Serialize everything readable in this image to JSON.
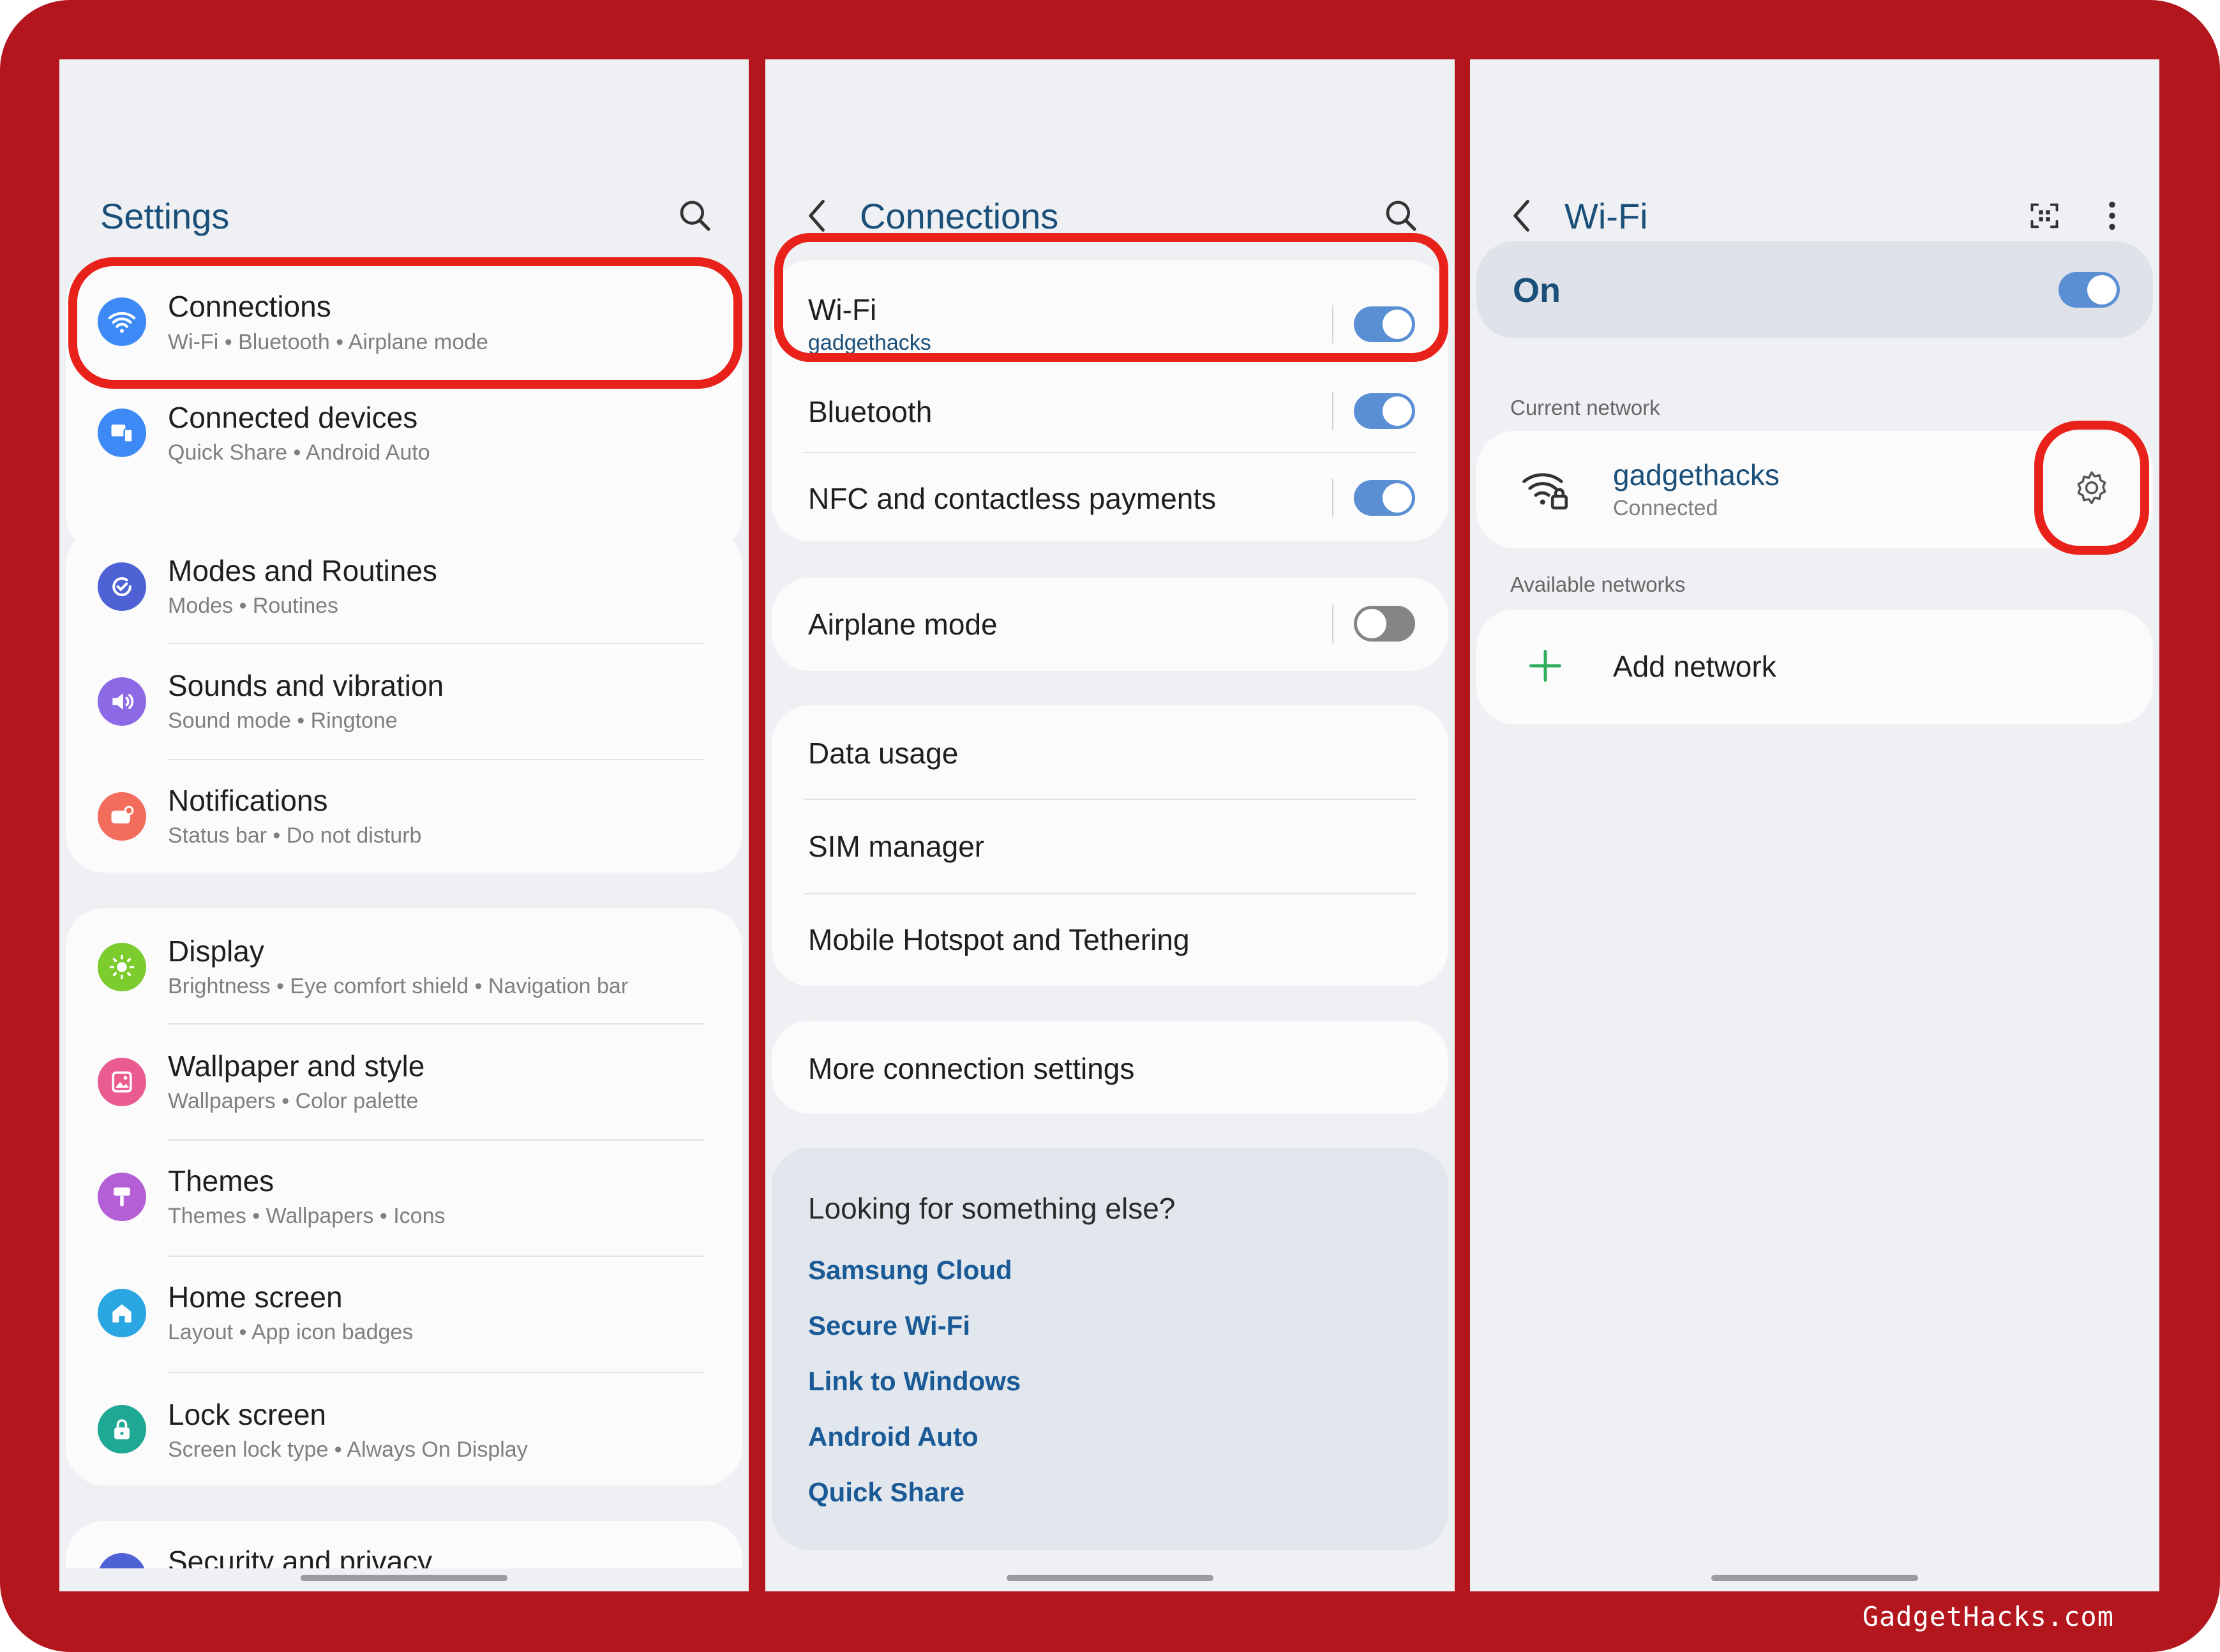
{
  "watermark": "GadgetHacks.com",
  "settings": {
    "title": "Settings",
    "items": [
      {
        "label": "Connections",
        "sub": "Wi-Fi  •  Bluetooth  •  Airplane mode",
        "icon": "wifi-icon",
        "color": "#3d8af7"
      },
      {
        "label": "Connected devices",
        "sub": "Quick Share  •  Android Auto",
        "icon": "devices-icon",
        "color": "#3d8af7"
      },
      {
        "label": "Modes and Routines",
        "sub": "Modes  •  Routines",
        "icon": "routines-icon",
        "color": "#4e62d6"
      },
      {
        "label": "Sounds and vibration",
        "sub": "Sound mode  •  Ringtone",
        "icon": "volume-icon",
        "color": "#8c6ae6"
      },
      {
        "label": "Notifications",
        "sub": "Status bar  •  Do not disturb",
        "icon": "notification-icon",
        "color": "#f36d5d"
      },
      {
        "label": "Display",
        "sub": "Brightness  •  Eye comfort shield  •  Navigation bar",
        "icon": "brightness-icon",
        "color": "#7ccc2d"
      },
      {
        "label": "Wallpaper and style",
        "sub": "Wallpapers  •  Color palette",
        "icon": "wallpaper-icon",
        "color": "#ea5b8f"
      },
      {
        "label": "Themes",
        "sub": "Themes  •  Wallpapers  •  Icons",
        "icon": "themes-icon",
        "color": "#b55fd6"
      },
      {
        "label": "Home screen",
        "sub": "Layout  •  App icon badges",
        "icon": "home-icon",
        "color": "#2aa6e2"
      },
      {
        "label": "Lock screen",
        "sub": "Screen lock type  •  Always On Display",
        "icon": "lock-icon",
        "color": "#1fa893"
      },
      {
        "label": "Security and privacy",
        "sub": "",
        "icon": "shield-icon",
        "color": "#4e62d6"
      }
    ]
  },
  "connections": {
    "title": "Connections",
    "wifi": {
      "label": "Wi-Fi",
      "sub": "gadgethacks",
      "on": true
    },
    "bluetooth": {
      "label": "Bluetooth",
      "on": true
    },
    "nfc": {
      "label": "NFC and contactless payments",
      "on": true
    },
    "airplane": {
      "label": "Airplane mode",
      "on": false
    },
    "data_usage": "Data usage",
    "sim_manager": "SIM manager",
    "hotspot": "Mobile Hotspot and Tethering",
    "more": "More connection settings",
    "looking": {
      "title": "Looking for something else?",
      "links": [
        "Samsung Cloud",
        "Secure Wi-Fi",
        "Link to Windows",
        "Android Auto",
        "Quick Share"
      ]
    }
  },
  "wifi": {
    "title": "Wi-Fi",
    "state": "On",
    "current_label": "Current network",
    "network_name": "gadgethacks",
    "network_status": "Connected",
    "available_label": "Available networks",
    "add_network": "Add network"
  }
}
